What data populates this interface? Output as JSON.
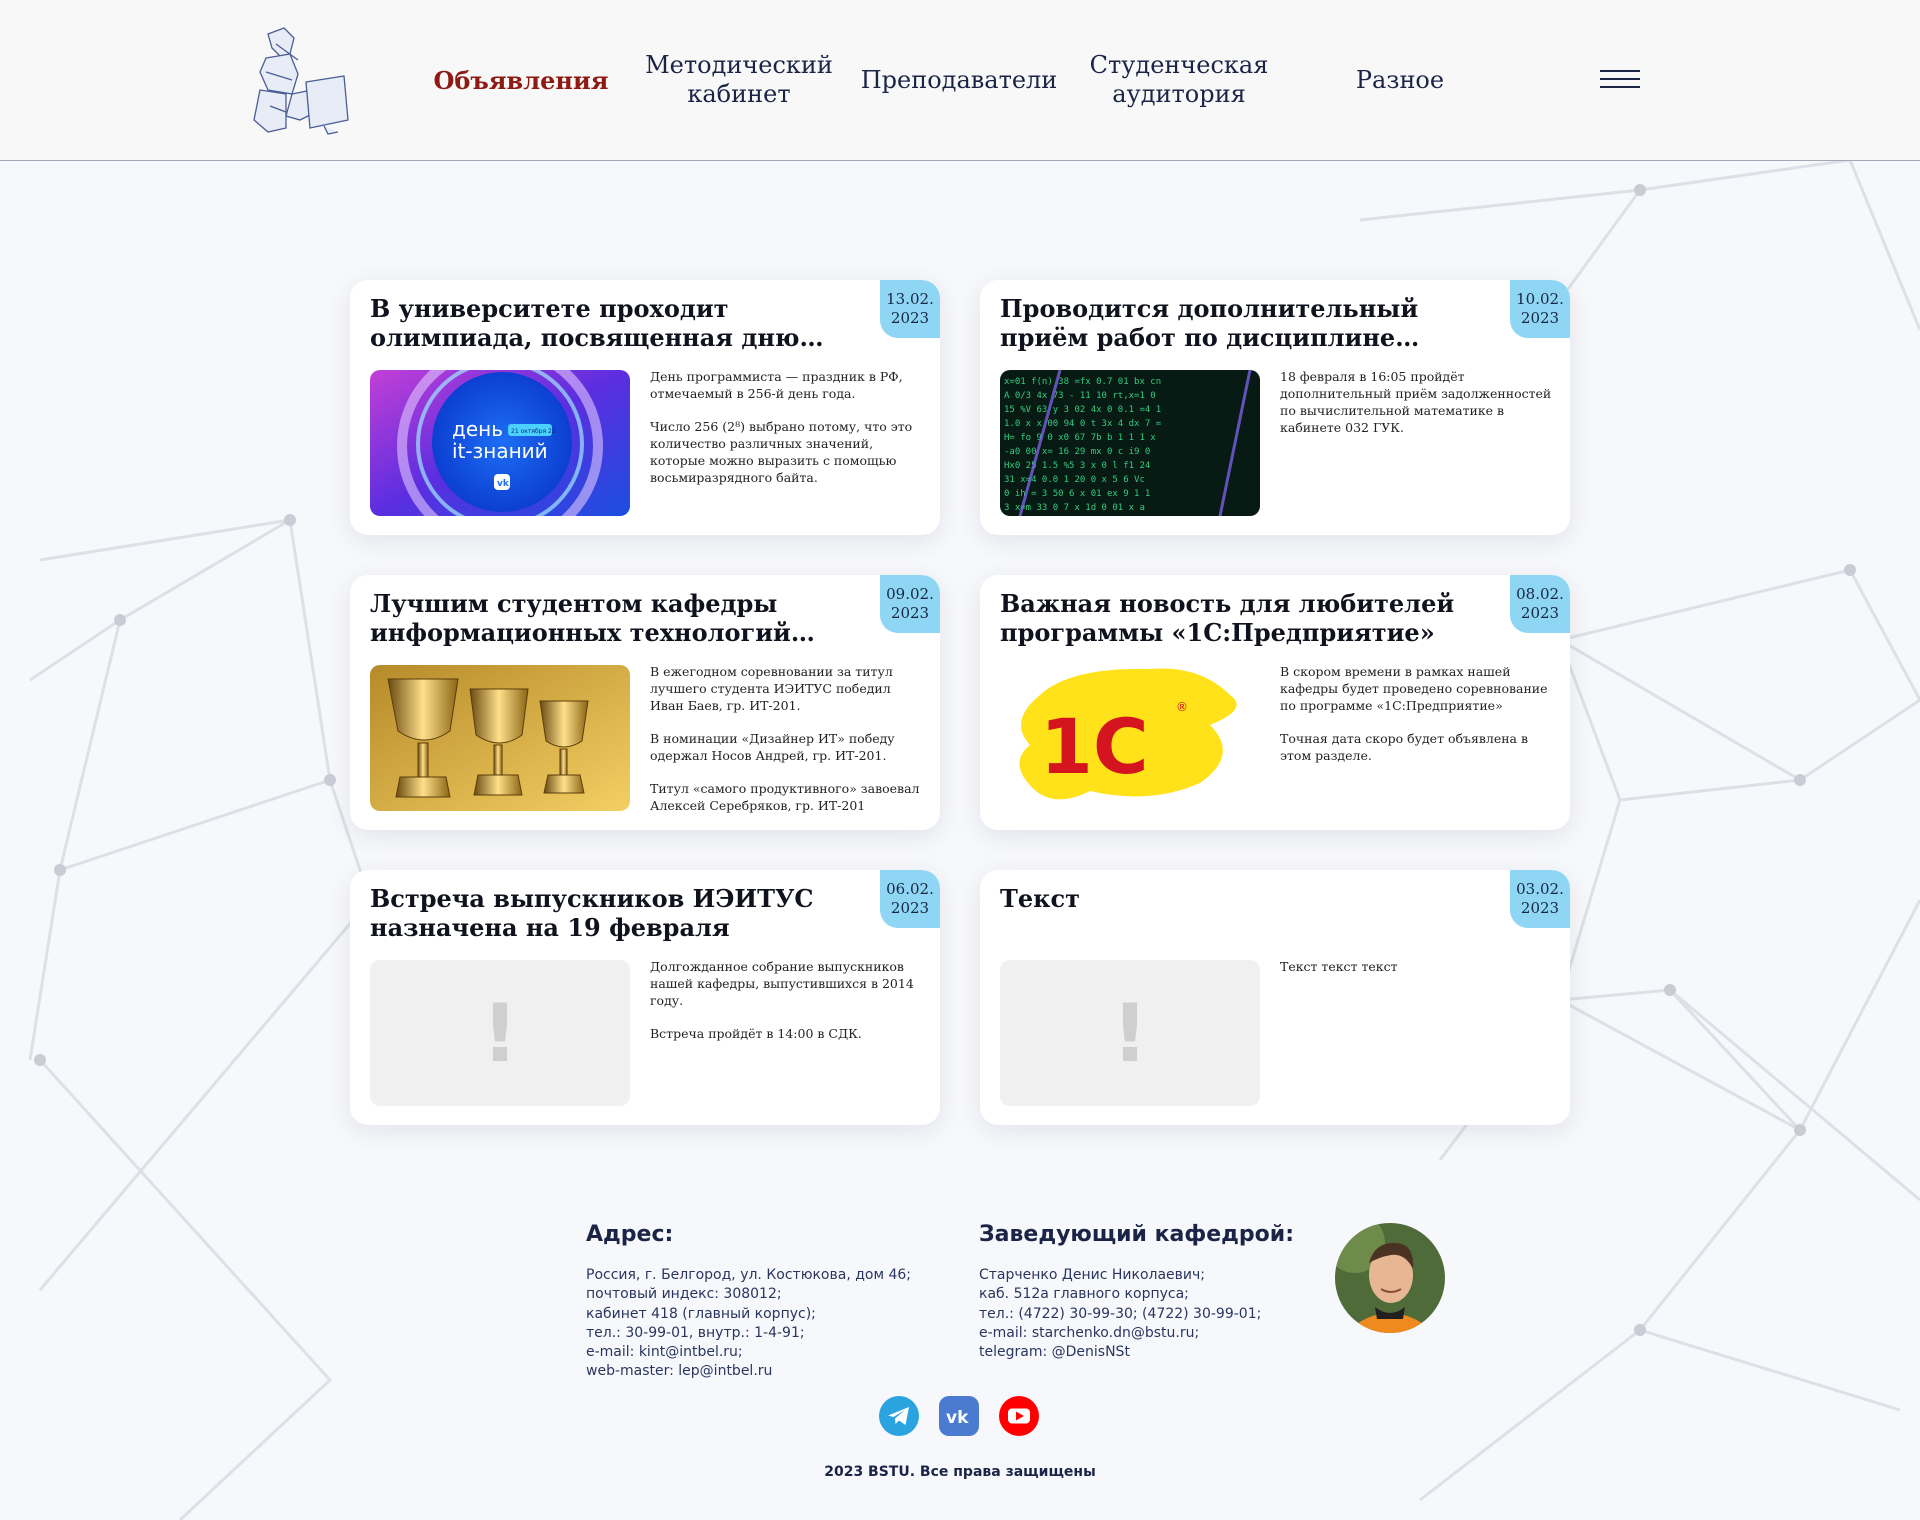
{
  "header": {
    "nav": [
      {
        "label": "Объявления",
        "active": true
      },
      {
        "label": "Методический кабинет",
        "active": false
      },
      {
        "label": "Преподаватели",
        "active": false
      },
      {
        "label": "Студенческая аудитория",
        "active": false
      },
      {
        "label": "Разное",
        "active": false
      }
    ],
    "logo_icon": "thinker-statue-icon",
    "menu_icon": "hamburger-icon"
  },
  "cards": [
    {
      "title": "В университете проходит олимпиада, посвященная дню информационных технологий",
      "date_day": "13.02.",
      "date_year": "2023",
      "image": "it-knowledge-day-banner",
      "image_text": "день it-знаний",
      "image_small": "21 октября 22",
      "paragraphs": [
        "День программиста — праздник в РФ, отмечаемый в 256-й день года.",
        "Число 256 (2⁸) выбрано потому, что это количество различных значений, которые можно выразить с помощью восьмиразрядного байта."
      ]
    },
    {
      "title": "Проводится дополнительный приём работ по дисциплине «Выч. математика»",
      "date_day": "10.02.",
      "date_year": "2023",
      "image": "green-code-screen",
      "paragraphs": [
        "18 февраля в 16:05 пройдёт дополнительный приём задолженностей по вычислительной математике в кабинете 032 ГУК."
      ]
    },
    {
      "title": "Лучшим студентом кафедры информационных технологий признан Иван Баев",
      "date_day": "09.02.",
      "date_year": "2023",
      "image": "golden-trophies",
      "paragraphs": [
        "В ежегодном соревновании за титул лучшего студента ИЭИТУС победил Иван Баев, гр. ИТ-201.",
        "В номинации «Дизайнер ИТ» победу одержал Носов Андрей, гр. ИТ-201.",
        "Титул «самого продуктивного» завоевал Алексей Серебряков, гр. ИТ-201"
      ]
    },
    {
      "title": "Важная новость для любителей программы «1С:Предприятие»",
      "date_day": "08.02.",
      "date_year": "2023",
      "image": "1c-logo",
      "image_text": "1С",
      "paragraphs": [
        "В скором времени в рамках нашей кафедры будет проведено соревнование по программе «1С:Предприятие»",
        "Точная дата скоро будет объявлена в этом разделе."
      ]
    },
    {
      "title": "Встреча выпускников ИЭИТУС назначена на 19 февраля",
      "date_day": "06.02.",
      "date_year": "2023",
      "image": "placeholder-exclamation",
      "image_text": "!",
      "paragraphs": [
        "Долгожданное собрание выпускников нашей кафедры, выпустившихся в 2014 году.",
        "Встреча пройдёт в 14:00 в СДК."
      ]
    },
    {
      "title": "Текст",
      "date_day": "03.02.",
      "date_year": "2023",
      "image": "placeholder-exclamation",
      "image_text": "!",
      "paragraphs": [
        "Текст текст текст"
      ]
    }
  ],
  "footer": {
    "address_title": "Адрес:",
    "address_lines": [
      "Россия, г. Белгород, ул. Костюкова, дом 46;",
      "почтовый индекс: 308012;",
      "кабинет 418 (главный корпус);",
      "тел.: 30-99-01, внутр.: 1-4-91;",
      "e-mail: kint@intbel.ru;",
      "web-master: lep@intbel.ru"
    ],
    "head_title": "Заведующий кафедрой:",
    "head_lines": [
      "Старченко Денис Николаевич;",
      "каб. 512а главного корпуса;",
      "тел.: (4722) 30-99-30; (4722) 30-99-01;",
      "e-mail: starchenko.dn@bstu.ru;",
      "telegram: @DenisNSt"
    ],
    "social": [
      "telegram-icon",
      "vk-icon",
      "youtube-icon"
    ],
    "copyright": "2023 BSTU. Все права защищены",
    "colors": {
      "telegram": "#2aa3df",
      "vk": "#4a7bd0",
      "youtube": "#ff0000"
    }
  },
  "colors": {
    "accent": "#8e1a14",
    "date_badge": "#8fd6f5",
    "navy": "#1b2447"
  }
}
